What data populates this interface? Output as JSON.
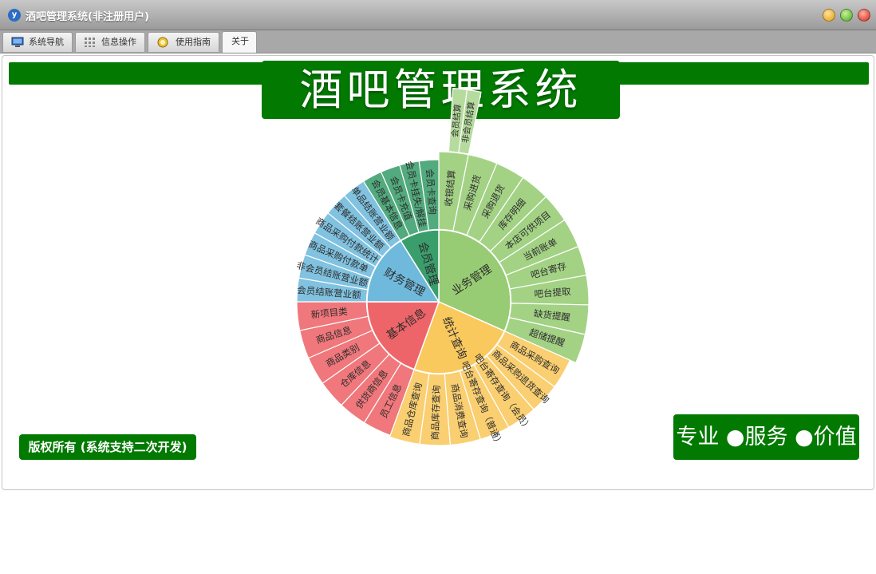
{
  "window": {
    "title": "酒吧管理系统(非注册用户)"
  },
  "tabs": [
    {
      "label": "系统导航",
      "icon": "monitor-icon"
    },
    {
      "label": "信息操作",
      "icon": "grid-icon"
    },
    {
      "label": "使用指南",
      "icon": "lightbulb-icon"
    },
    {
      "label": "关于",
      "icon": ""
    }
  ],
  "active_tab": "关于",
  "banner": {
    "title": "酒吧管理系统"
  },
  "footer": {
    "copyright": "版权所有 (系统支持二次开发)",
    "slogan": "专业 ●服务 ●价值"
  },
  "colors": {
    "brand_green": "#027a02",
    "member": "#3a9e6c",
    "business": "#97cc74",
    "stats": "#f9c95e",
    "basic": "#ee6569",
    "finance": "#6fbadc"
  },
  "sunburst": {
    "groups": [
      {
        "name": "业务管理",
        "color": "#97cc74",
        "items": [
          {
            "label": "收银结算",
            "children": [
              "",
              "会员结算",
              "非会员结算"
            ]
          },
          {
            "label": "采购进货"
          },
          {
            "label": "采购退货"
          },
          {
            "label": "库存明细"
          },
          {
            "label": "本店可供项目"
          },
          {
            "label": "当前账单"
          },
          {
            "label": "吧台寄存"
          },
          {
            "label": "吧台提取"
          },
          {
            "label": "缺货提醒"
          },
          {
            "label": "超储提醒"
          }
        ]
      },
      {
        "name": "统计查询",
        "color": "#f9c95e",
        "items": [
          {
            "label": "商品采购查询"
          },
          {
            "label": "商品采购退货查询"
          },
          {
            "label": "吧台寄存查询（会员）"
          },
          {
            "label": "吧台寄存查询（普通）"
          },
          {
            "label": "商品消费查询"
          },
          {
            "label": "商品库存查询"
          },
          {
            "label": "商品仓库查询"
          }
        ]
      },
      {
        "name": "基本信息",
        "color": "#ee6569",
        "items": [
          {
            "label": "员工信息"
          },
          {
            "label": "供货商信息"
          },
          {
            "label": "仓库信息"
          },
          {
            "label": "商品类别"
          },
          {
            "label": "商品信息"
          },
          {
            "label": "新项目类"
          }
        ]
      },
      {
        "name": "财务管理",
        "color": "#6fbadc",
        "items": [
          {
            "label": "会员结账营业额"
          },
          {
            "label": "非会员结账营业额"
          },
          {
            "label": "商品采购付款单"
          },
          {
            "label": "商品采购付款统计"
          },
          {
            "label": "套餐结账营业额"
          },
          {
            "label": "单品结账营业额"
          }
        ]
      },
      {
        "name": "会员管理",
        "color": "#3a9e6c",
        "items": [
          {
            "label": "会员基本信息"
          },
          {
            "label": "会员卡充值"
          },
          {
            "label": "会员卡挂失/解挂"
          },
          {
            "label": "会员卡查询"
          }
        ]
      }
    ]
  }
}
